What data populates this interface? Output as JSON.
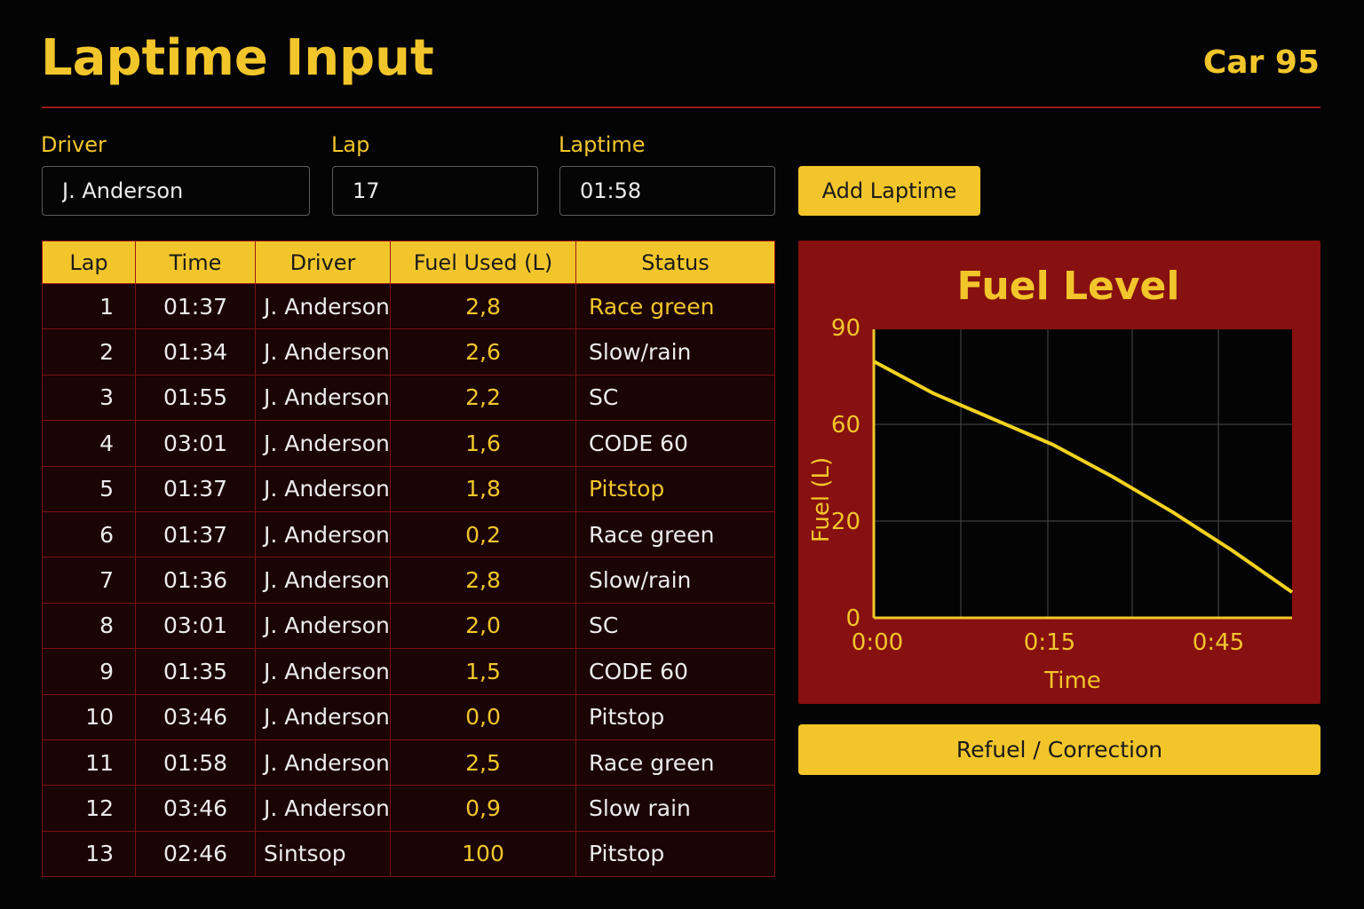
{
  "header": {
    "title": "Laptime Input",
    "car": "Car 95"
  },
  "form": {
    "driver_label": "Driver",
    "driver_value": "J. Anderson",
    "lap_label": "Lap",
    "lap_value": "17",
    "laptime_label": "Laptime",
    "laptime_value": "01:58",
    "add_button": "Add Laptime"
  },
  "table": {
    "headers": [
      "Lap",
      "Time",
      "Driver",
      "Fuel Used (L)",
      "Status"
    ],
    "rows": [
      {
        "lap": "1",
        "time": "01:37",
        "driver": "J. Anderson",
        "fuel": "2,8",
        "status": "Race green"
      },
      {
        "lap": "2",
        "time": "01:34",
        "driver": "J. Anderson",
        "fuel": "2,6",
        "status": "Slow/rain"
      },
      {
        "lap": "3",
        "time": "01:55",
        "driver": "J. Anderson",
        "fuel": "2,2",
        "status": "SC"
      },
      {
        "lap": "4",
        "time": "03:01",
        "driver": "J. Anderson",
        "fuel": "1,6",
        "status": "CODE 60"
      },
      {
        "lap": "5",
        "time": "01:37",
        "driver": "J. Anderson",
        "fuel": "1,8",
        "status": "Pitstop"
      },
      {
        "lap": "6",
        "time": "01:37",
        "driver": "J. Anderson",
        "fuel": "0,2",
        "status": "Race green"
      },
      {
        "lap": "7",
        "time": "01:36",
        "driver": "J. Anderson",
        "fuel": "2,8",
        "status": "Slow/rain"
      },
      {
        "lap": "8",
        "time": "03:01",
        "driver": "J. Anderson",
        "fuel": "2,0",
        "status": "SC"
      },
      {
        "lap": "9",
        "time": "01:35",
        "driver": "J. Anderson",
        "fuel": "1,5",
        "status": "CODE 60"
      },
      {
        "lap": "10",
        "time": "03:46",
        "driver": "J. Anderson",
        "fuel": "0,0",
        "status": "Pitstop"
      },
      {
        "lap": "11",
        "time": "01:58",
        "driver": "J. Anderson",
        "fuel": "2,5",
        "status": "Race green"
      },
      {
        "lap": "12",
        "time": "03:46",
        "driver": "J. Anderson",
        "fuel": "0,9",
        "status": "Slow rain"
      },
      {
        "lap": "13",
        "time": "02:46",
        "driver": "Sintsop",
        "fuel": "100",
        "status": "Pitstop"
      }
    ]
  },
  "chart_data": {
    "type": "line",
    "title": "Fuel Level",
    "xlabel": "Time",
    "ylabel": "Fuel (L)",
    "x_ticks": [
      "0:00",
      "0:15",
      "0:45"
    ],
    "y_ticks": [
      "0",
      "20",
      "60",
      "90"
    ],
    "grid": true,
    "series": [
      {
        "values": [
          80,
          70,
          62,
          54,
          44,
          33,
          21,
          8
        ]
      }
    ]
  },
  "refuel_button": "Refuel / Correction",
  "colors": {
    "accent": "#f2c62b",
    "panel": "#871010",
    "row_bg": "#1b0404",
    "border": "#9c1818",
    "background": "#040404"
  }
}
